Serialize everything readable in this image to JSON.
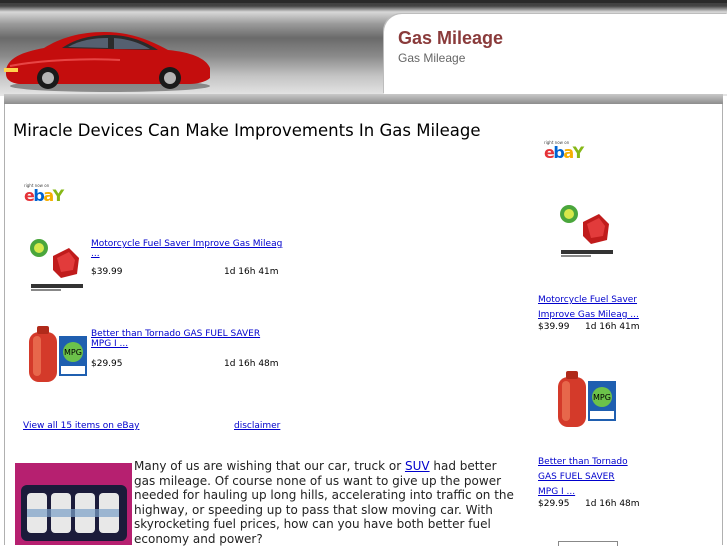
{
  "header": {
    "site_title": "Gas Mileage",
    "site_subtitle": "Gas Mileage"
  },
  "main": {
    "headline": "Miracle Devices Can Make Improvements In Gas Mileage",
    "ebay_widget": {
      "tagline": "right now on",
      "items": [
        {
          "title_line1": "Motorcycle Fuel Saver Improve Gas Mileag",
          "title_line2": "...",
          "price": "$39.99",
          "time_left": "1d 16h 41m"
        },
        {
          "title_line1": "Better than Tornado GAS FUEL SAVER",
          "title_line2": "MPG I ...",
          "price": "$29.95",
          "time_left": "1d 16h 48m"
        }
      ],
      "view_all": "View all 15 items on eBay",
      "disclaimer": "disclaimer"
    },
    "article": {
      "text_before_link": "Many of us are wishing that our car, truck or ",
      "link_text": "SUV",
      "text_after_link": " had better gas mileage. Of course none of us want to give up the power needed for hauling up long hills, accelerating into traffic on the highway, or speeding up to pass that slow moving car. With skyrocketing fuel prices, how can you have both better fuel economy and power?"
    }
  },
  "sidebar": {
    "ebay_widget": {
      "tagline": "right now on",
      "items": [
        {
          "title_line1": "Motorcycle Fuel Saver",
          "title_line2": "Improve Gas Mileag ...",
          "price": "$39.99",
          "time_left": "1d 16h 41m"
        },
        {
          "title_line1": "Better than Tornado",
          "title_line2": "GAS FUEL SAVER",
          "title_line3": "MPG I ...",
          "price": "$29.95",
          "time_left": "1d 16h 48m"
        }
      ]
    }
  },
  "colors": {
    "site_title": "#8a3b3b",
    "link": "#0000cc",
    "car": "#d01010"
  },
  "icons": {
    "logo": "ebay-logo",
    "product_1": "fuel-saver-device-icon",
    "product_2": "fuel-saver-canister-icon"
  }
}
